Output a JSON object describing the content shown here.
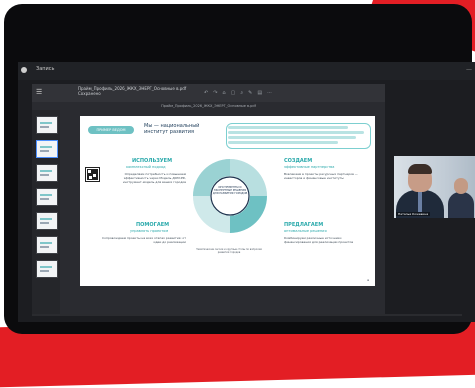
{
  "window": {
    "title": "Запись",
    "minimize": "—"
  },
  "viewer": {
    "file_name": "Прайм_Профиль_2026_ЖКХ_ЭНЕРГ_Основные в.pdf",
    "file_subtitle": "Сохранено",
    "doc_title": "Прайм_Профиль_2026_ЖКХ_ЭНЕРГ_Основные в.pdf",
    "toolbar_icons": [
      "↶",
      "↷",
      "⌂",
      "▢",
      "⌕",
      "✎",
      "▤",
      "⋯"
    ],
    "menu_icon": "☰"
  },
  "slide": {
    "pill": "ПРИМЕР ВЕДОМ",
    "title": "Мы — национальный институт развития",
    "sections": [
      {
        "title": "ИСПОЛЬЗУЕМ",
        "subtitle": "комплексный подход",
        "text": "Определяем потребность и повышаем эффективность через Модель ДОМ.РФ, инструмент-модель для ваших городов"
      },
      {
        "title": "ПОМОГАЕМ",
        "subtitle": "управлять проектом",
        "text": "Сопровождаем проекты на всех этапах развития: от идеи до реализации"
      },
      {
        "title": "СОЗДАЕМ",
        "subtitle": "эффективные партнерства",
        "text": "Вовлекаем в проекты ресурсных партнеров — инвесторов и финансовые институты"
      },
      {
        "title": "ПРЕДЛАГАЕМ",
        "subtitle": "оптимальные решения",
        "text": "Комбинируем различные источники финансирования для реализации проектов"
      }
    ],
    "center": "ИНСТРУМЕНТЫ И ЭКСПЕРТНЫЕ РЕШЕНИЯ ДЛЯ РАЗВИТИЯ ГОРОДОВ",
    "caption": "Тематические сессии и круглые столы по вопросам развития городов"
  },
  "video": {
    "participant": "Наталья Кожевина"
  },
  "colors": {
    "accent": "#2aa9ab",
    "frame": "#e31e24",
    "navy": "#1b3a57"
  }
}
